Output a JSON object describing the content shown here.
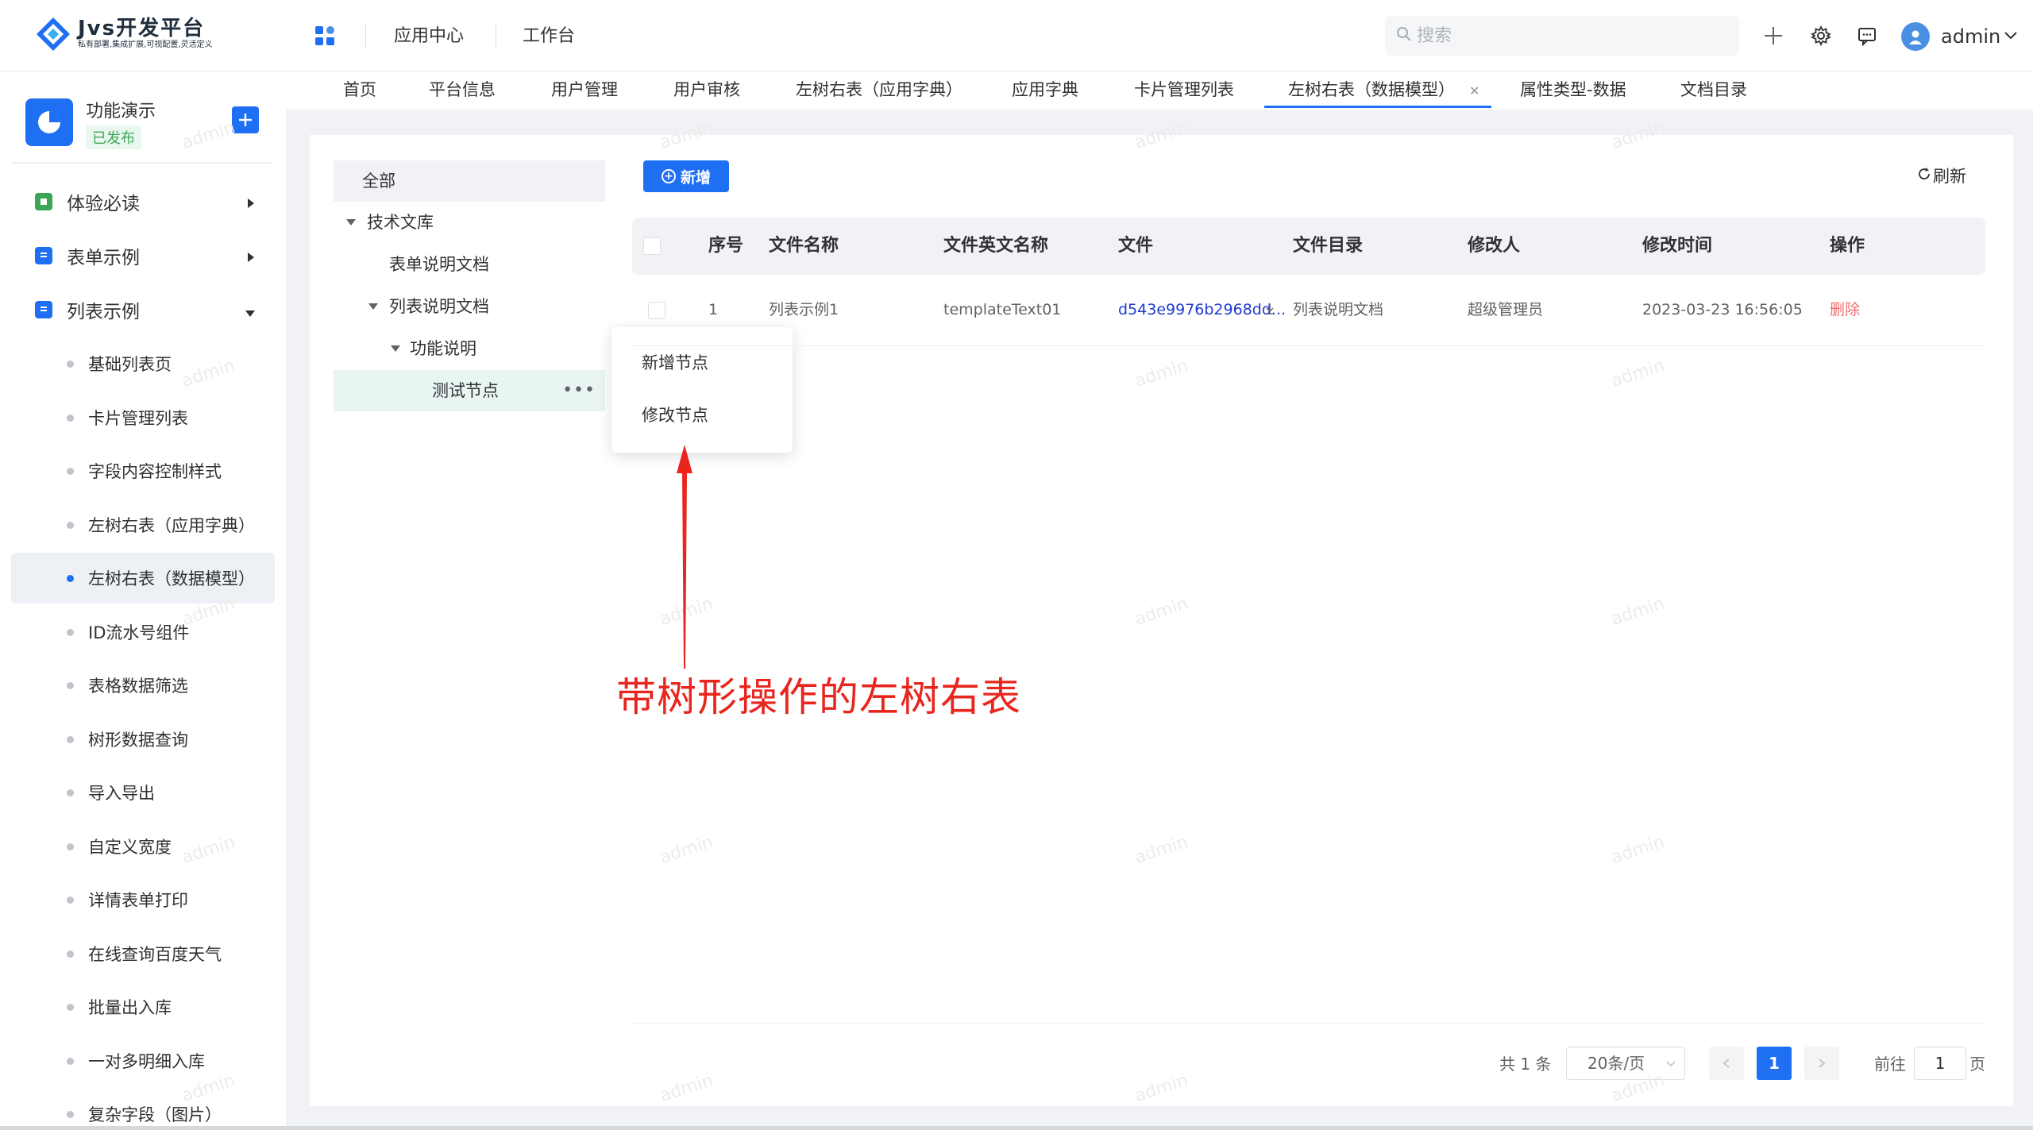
{
  "brand": {
    "title": "Jvs开发平台",
    "subtitle": "私有部署,集成扩展,可视配置,灵活定义"
  },
  "header": {
    "nav": [
      "应用中心",
      "工作台"
    ],
    "search_placeholder": "搜索",
    "user": "admin"
  },
  "app": {
    "name": "功能演示",
    "status": "已发布"
  },
  "sidebar": {
    "groups": [
      {
        "label": "体验必读",
        "color": "#3aa757"
      },
      {
        "label": "表单示例",
        "color": "#1e6ff2"
      },
      {
        "label": "列表示例",
        "color": "#1e6ff2"
      }
    ],
    "items": [
      "基础列表页",
      "卡片管理列表",
      "字段内容控制样式",
      "左树右表（应用字典）",
      "左树右表（数据模型）",
      "ID流水号组件",
      "表格数据筛选",
      "树形数据查询",
      "导入导出",
      "自定义宽度",
      "详情表单打印",
      "在线查询百度天气",
      "批量出入库",
      "一对多明细入库",
      "复杂字段（图片）"
    ],
    "active_item": "左树右表（数据模型）"
  },
  "tabs": [
    "首页",
    "平台信息",
    "用户管理",
    "用户审核",
    "左树右表（应用字典）",
    "应用字典",
    "卡片管理列表",
    "左树右表（数据模型）",
    "属性类型-数据",
    "文档目录"
  ],
  "active_tab": "左树右表（数据模型）",
  "tree": {
    "root": "全部",
    "nodes": [
      "技术文库",
      "表单说明文档",
      "列表说明文档",
      "功能说明",
      "测试节点"
    ],
    "selected": "测试节点",
    "more": "•••"
  },
  "popup": {
    "items": [
      "新增节点",
      "修改节点"
    ]
  },
  "toolbar": {
    "add_label": "新增",
    "refresh_label": "刷新"
  },
  "table": {
    "headers": [
      "序号",
      "文件名称",
      "文件英文名称",
      "文件",
      "文件目录",
      "修改人",
      "修改时间",
      "操作"
    ],
    "rows": [
      [
        "1",
        "列表示例1",
        "templateText01",
        "d543e9976b2968dd...",
        "列表说明文档",
        "超级管理员",
        "2023-03-23 16:56:05",
        "删除"
      ]
    ]
  },
  "pagination": {
    "total": "共 1 条",
    "page_size": "20条/页",
    "current": "1",
    "goto_prefix": "前往",
    "goto_value": "1",
    "goto_suffix": "页"
  },
  "annotation": "带树形操作的左树右表",
  "watermark": "admin",
  "colors": {
    "primary": "#1e6ff2",
    "danger": "#f56c6c",
    "annotation": "#e8261e",
    "success": "#3aa757"
  }
}
